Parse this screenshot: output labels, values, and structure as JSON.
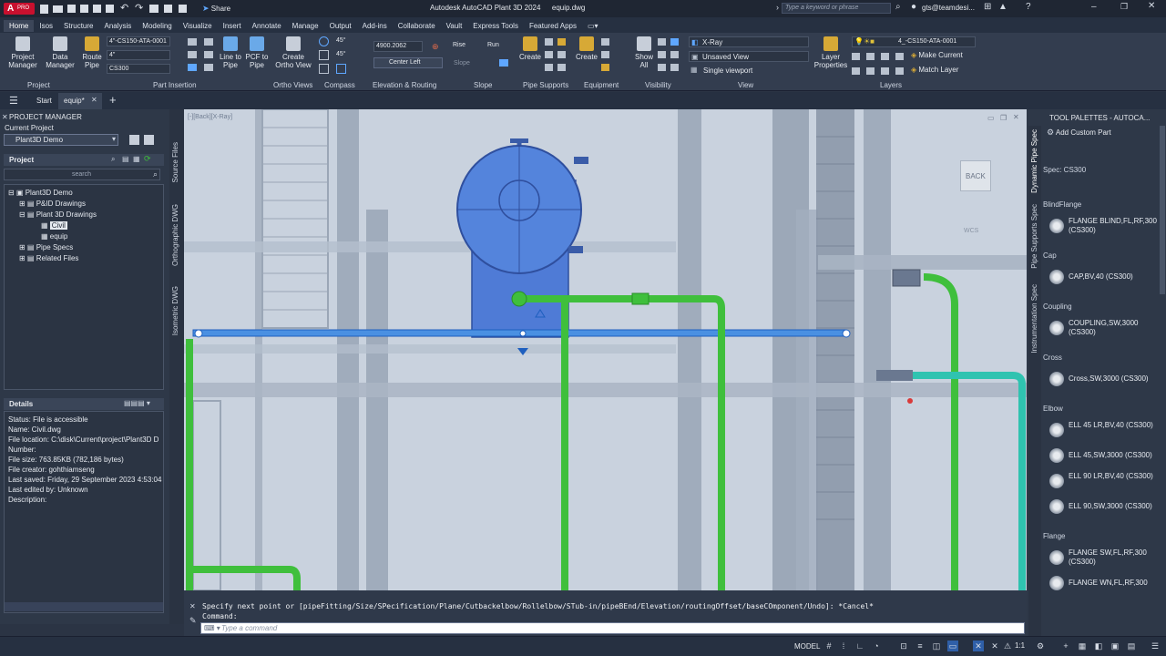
{
  "app": {
    "title": "Autodesk AutoCAD Plant 3D 2024",
    "doc": "equip.dwg",
    "share_label": "Share",
    "search_placeholder": "Type a keyword or phrase",
    "user": "gts@teamdesi...",
    "logo_letter": "A",
    "logo_badge": "PRO"
  },
  "menu_tabs": [
    "Home",
    "Isos",
    "Structure",
    "Analysis",
    "Modeling",
    "Visualize",
    "Insert",
    "Annotate",
    "Manage",
    "Output",
    "Add-ins",
    "Collaborate",
    "Vault",
    "Express Tools",
    "Featured Apps"
  ],
  "ribbon": {
    "project_manager": "Project\nManager",
    "data_manager": "Data\nManager",
    "route_pipe": "Route\nPipe",
    "line_to_pipe": "Line to\nPipe",
    "pcf_to_pipe": "PCF to\nPipe",
    "create_ortho": "Create\nOrtho View",
    "spec_value": "4\"-CS150-ATA-0001",
    "size_value": "4\"",
    "spec2_value": "CS300",
    "angle1": "45°",
    "angle2": "45°",
    "elevation_value": "4900.2062",
    "center_left": "Center Left",
    "rise": "Rise",
    "run": "Run",
    "slope": "Slope",
    "create1": "Create",
    "create2": "Create",
    "show_all": "Show\nAll",
    "xray": "X-Ray",
    "unsaved_view": "Unsaved View",
    "single_viewport": "Single viewport",
    "layer_properties": "Layer\nProperties",
    "layer_value": "4_-CS150-ATA-0001",
    "make_current": "Make Current",
    "match_layer": "Match Layer",
    "panels": [
      "Project",
      "Part Insertion",
      "Ortho Views",
      "Compass",
      "Elevation & Routing",
      "Slope",
      "Pipe Supports",
      "Equipment",
      "Visibility",
      "View",
      "Layers"
    ]
  },
  "doc_tabs": {
    "start": "Start",
    "active": "equip*"
  },
  "project_manager": {
    "title": "PROJECT MANAGER",
    "current_project_label": "Current Project",
    "current_project": "Plant3D Demo",
    "project_label": "Project",
    "search_placeholder": "search",
    "tree": [
      "Plant3D Demo",
      "P&ID Drawings",
      "Plant 3D Drawings",
      "Civil",
      "equip",
      "Pipe Specs",
      "Related Files"
    ],
    "details_title": "Details",
    "details": [
      "Status: File is accessible",
      "Name: Civil.dwg",
      "File location: C:\\disk\\Current\\project\\Plant3D D",
      "Number:",
      "File size: 763.85KB (782,186 bytes)",
      "File creator: gohthiamseng",
      "Last saved: Friday, 29 September 2023 4:53:04",
      "Last edited by: Unknown",
      "Description:"
    ]
  },
  "side_tabs": [
    "Source Files",
    "Orthographic DWG",
    "Isometric DWG"
  ],
  "viewport": {
    "label": "[-][Back][X-Ray]",
    "back": "BACK",
    "wcs": "WCS"
  },
  "command": {
    "history": "Specify next point or [pipeFitting/Size/SPecification/Plane/Cutbackelbow/Rollelbow/STub-in/pipeBEnd/Elevation/routingOffset/baseCOmponent/Undo]: *Cancel*",
    "prompt": "Command:",
    "placeholder": "Type a command"
  },
  "tool_palettes": {
    "title": "TOOL PALETTES - AUTOCA...",
    "add_custom": "Add Custom Part",
    "spec": "Spec: CS300",
    "tabs": [
      "Dynamic Pipe Spec",
      "Pipe Supports Spec",
      "Instrumentation Spec"
    ],
    "groups": [
      {
        "name": "BlindFlange",
        "items": [
          "FLANGE BLIND,FL,RF,300 (CS300)"
        ]
      },
      {
        "name": "Cap",
        "items": [
          "CAP,BV,40 (CS300)"
        ]
      },
      {
        "name": "Coupling",
        "items": [
          "COUPLING,SW,3000 (CS300)"
        ]
      },
      {
        "name": "Cross",
        "items": [
          "Cross,SW,3000 (CS300)"
        ]
      },
      {
        "name": "Elbow",
        "items": [
          "ELL 45 LR,BV,40 (CS300)",
          "ELL 45,SW,3000 (CS300)",
          "ELL 90 LR,BV,40 (CS300)",
          "ELL 90,SW,3000 (CS300)"
        ]
      },
      {
        "name": "Flange",
        "items": [
          "FLANGE SW,FL,RF,300 (CS300)",
          "FLANGE WN,FL,RF,300"
        ]
      }
    ]
  },
  "status": {
    "model": "MODEL",
    "scale": "1:1"
  },
  "colors": {
    "vessel": "#4f7bd6",
    "pipe_green": "#3fbf3c",
    "pipe_teal": "#2fc3b0",
    "steel": "#8f9bab"
  }
}
